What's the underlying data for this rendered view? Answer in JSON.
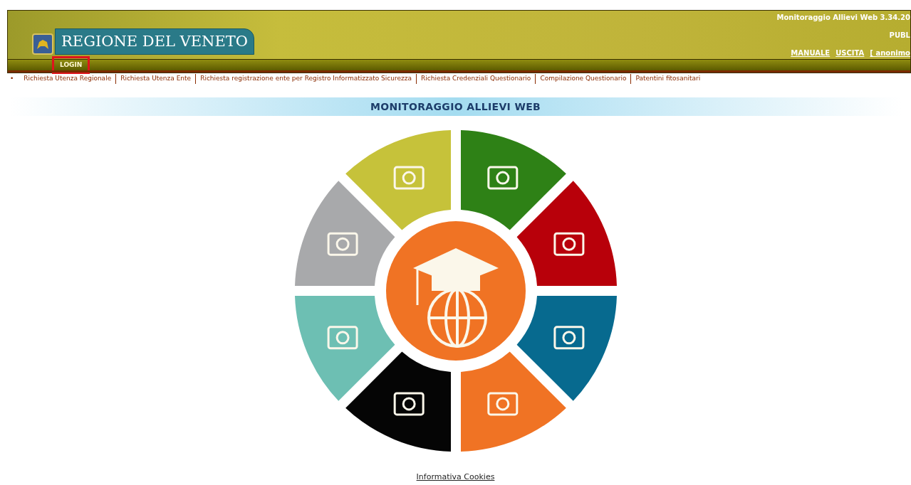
{
  "header": {
    "brand": "REGIONE DEL VENETO",
    "app_version": "Monitoraggio Allievi Web 3.34.20",
    "profile": "PUBL",
    "links": [
      {
        "label": "MANUALE"
      },
      {
        "label": "USCITA"
      }
    ],
    "user": "[ anonimo",
    "menu": [
      {
        "label": "LOGIN",
        "highlighted": true
      }
    ]
  },
  "nav": {
    "bullet": "•",
    "links": [
      "Richiesta Utenza Regionale",
      "Richiesta Utenza Ente",
      "Richiesta registrazione ente per Registro Informatizzato Sicurezza",
      "Richiesta Credenziali Questionario",
      "Compilazione Questionario",
      "Patentini fitosanitari"
    ]
  },
  "title": "MONITORAGGIO ALLIEVI WEB",
  "footer": {
    "link": "Informativa Cookies"
  }
}
